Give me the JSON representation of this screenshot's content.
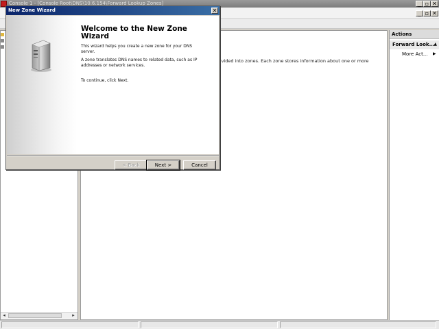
{
  "mmc": {
    "title": "Console 1 - [Console Root\\DNS\\10.6.154\\Forward Lookup Zones]",
    "content_text": "livided into zones. Each zone stores information about one or more",
    "actions": {
      "header": "Actions",
      "section": "Forward Look...",
      "item": "More Act..."
    }
  },
  "wizard": {
    "title": "New Zone Wizard",
    "close_glyph": "✕",
    "heading": "Welcome to the New Zone Wizard",
    "paragraph1": "This wizard helps you create a new zone for your DNS server.",
    "paragraph2": "A zone translates DNS names to related data, such as IP addresses or network services.",
    "paragraph3": "To continue, click Next.",
    "buttons": {
      "back": "< Back",
      "next": "Next >",
      "cancel": "Cancel"
    }
  },
  "colors": {
    "wizard_title_start": "#0a246a",
    "wizard_title_end": "#3a6ea5",
    "app_icon": "#c21d1d"
  },
  "icons": {
    "server": "server-icon",
    "close": "close-icon",
    "minimize": "minimize-icon",
    "restore": "restore-icon"
  }
}
